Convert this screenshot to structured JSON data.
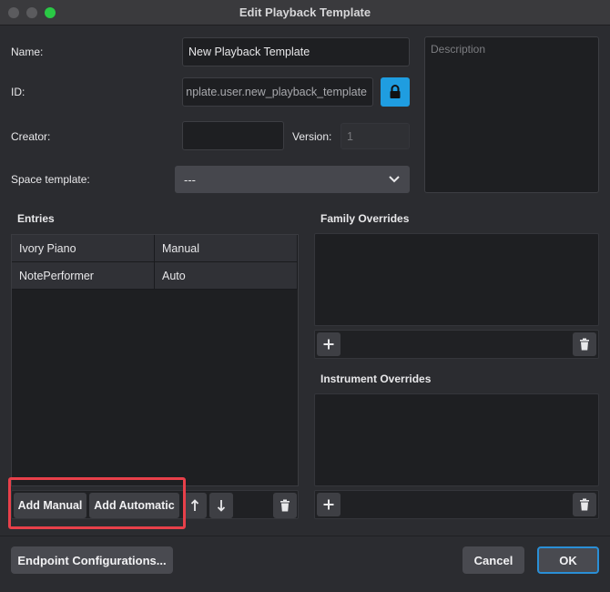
{
  "window": {
    "title": "Edit Playback Template"
  },
  "form": {
    "name_label": "Name:",
    "name_value": "New Playback Template",
    "id_label": "ID:",
    "id_value": "nplate.user.new_playback_template",
    "creator_label": "Creator:",
    "creator_value": "",
    "version_label": "Version:",
    "version_value": "1",
    "space_template_label": "Space template:",
    "space_template_value": "---",
    "description_placeholder": "Description"
  },
  "entries": {
    "title": "Entries",
    "rows": [
      {
        "name": "Ivory Piano",
        "mode": "Manual"
      },
      {
        "name": "NotePerformer",
        "mode": "Auto"
      }
    ],
    "add_manual_label": "Add Manual",
    "add_automatic_label": "Add Automatic"
  },
  "family_overrides": {
    "title": "Family Overrides"
  },
  "instrument_overrides": {
    "title": "Instrument Overrides"
  },
  "footer": {
    "endpoint_label": "Endpoint Configurations...",
    "cancel_label": "Cancel",
    "ok_label": "OK"
  },
  "colors": {
    "accent": "#1f9de0",
    "highlight": "#e8404a",
    "maximize": "#2ac845"
  }
}
